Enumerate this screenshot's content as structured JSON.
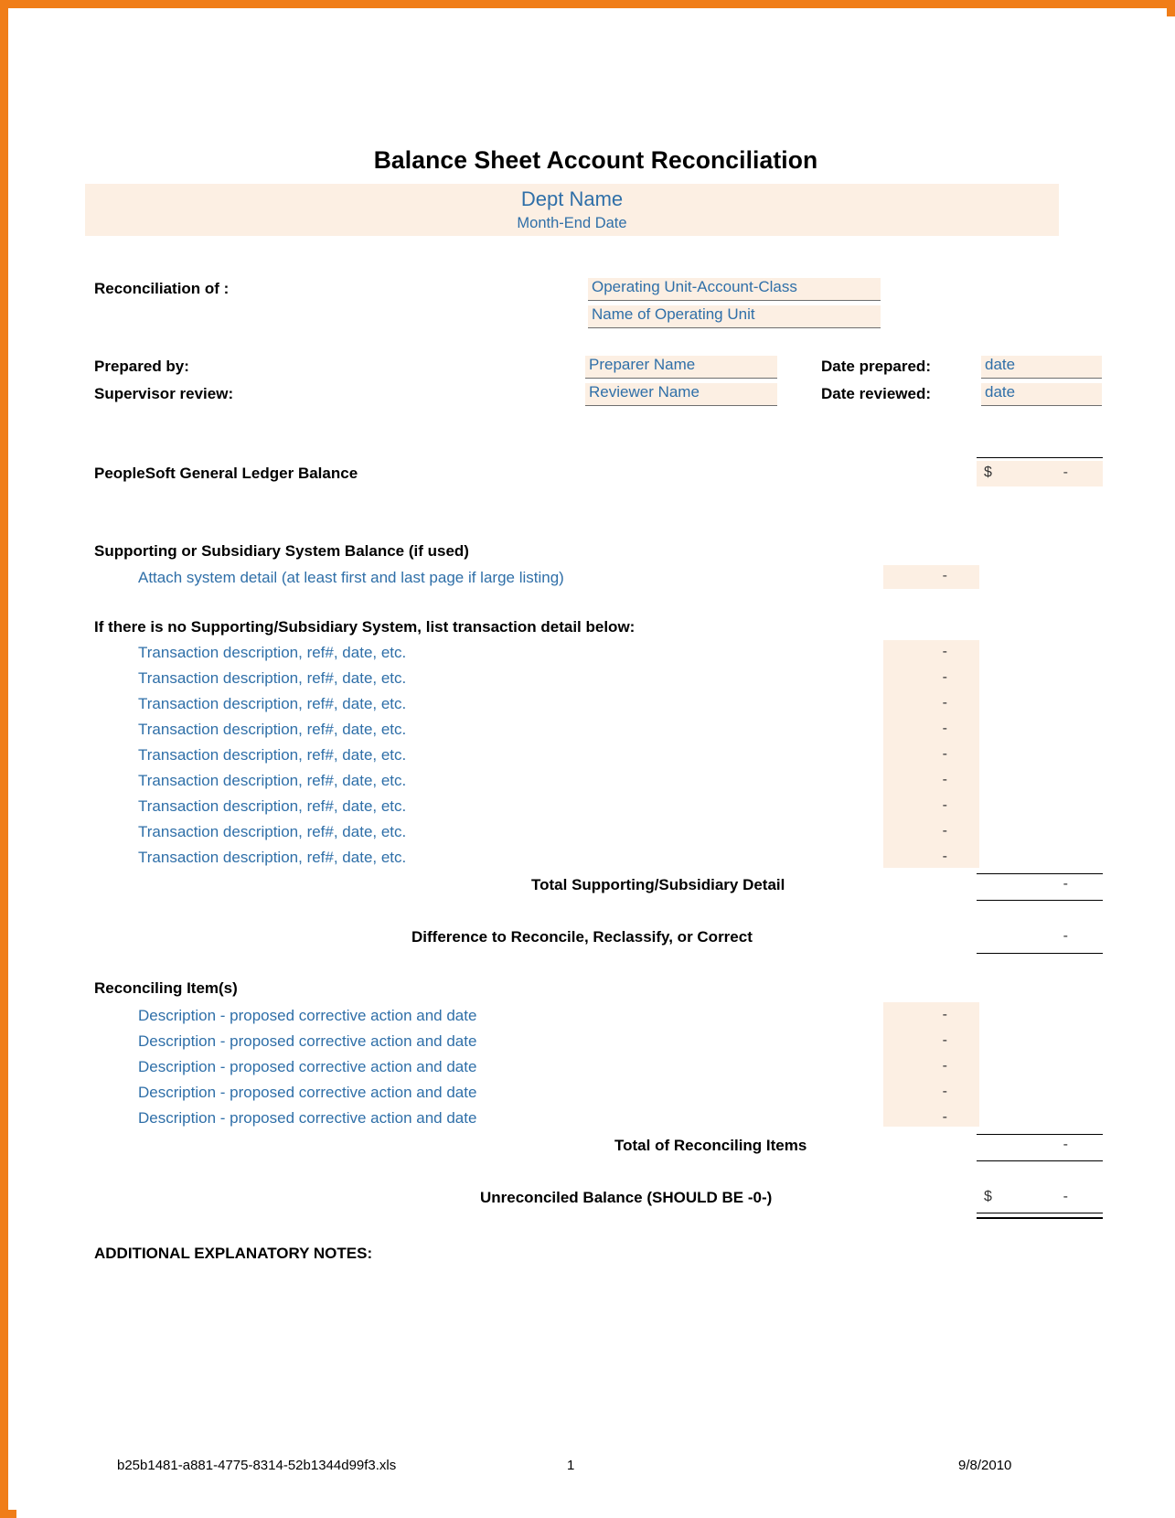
{
  "document": {
    "title": "Balance Sheet Account Reconciliation",
    "header_band": {
      "dept": "Dept Name",
      "period": "Month-End Date"
    },
    "reconciliation_of": {
      "label": "Reconciliation of :",
      "line1": "Operating Unit-Account-Class",
      "line2": "Name of Operating Unit"
    },
    "signoff": {
      "prepared_by_label": "Prepared by:",
      "prepared_by_value": "Preparer Name",
      "date_prepared_label": "Date prepared:",
      "date_prepared_value": "date",
      "supervisor_label": "Supervisor review:",
      "supervisor_value": "Reviewer Name",
      "date_reviewed_label": "Date reviewed:",
      "date_reviewed_value": "date"
    },
    "gl_balance": {
      "label": "PeopleSoft General Ledger Balance",
      "currency": "$",
      "value": "-"
    },
    "supporting": {
      "heading": "Supporting or Subsidiary System Balance (if used)",
      "note": "Attach system detail (at least first and last page if large listing)",
      "value": "-"
    },
    "transactions": {
      "heading": "If there is no Supporting/Subsidiary System, list transaction detail below:",
      "rows": [
        {
          "description": "Transaction description, ref#, date, etc.",
          "value": "-"
        },
        {
          "description": "Transaction description, ref#, date, etc.",
          "value": "-"
        },
        {
          "description": "Transaction description, ref#, date, etc.",
          "value": "-"
        },
        {
          "description": "Transaction description, ref#, date, etc.",
          "value": "-"
        },
        {
          "description": "Transaction description, ref#, date, etc.",
          "value": "-"
        },
        {
          "description": "Transaction description, ref#, date, etc.",
          "value": "-"
        },
        {
          "description": "Transaction description, ref#, date, etc.",
          "value": "-"
        },
        {
          "description": "Transaction description, ref#, date, etc.",
          "value": "-"
        },
        {
          "description": "Transaction description, ref#, date, etc.",
          "value": "-"
        }
      ]
    },
    "total_supporting": {
      "label": "Total Supporting/Subsidiary Detail",
      "value": "-"
    },
    "difference": {
      "label": "Difference to Reconcile, Reclassify, or Correct",
      "value": "-"
    },
    "reconciling_items": {
      "heading": "Reconciling Item(s)",
      "rows": [
        {
          "description": "Description - proposed corrective action and date",
          "value": "-"
        },
        {
          "description": "Description - proposed corrective action and date",
          "value": "-"
        },
        {
          "description": "Description - proposed corrective action and date",
          "value": "-"
        },
        {
          "description": "Description - proposed corrective action and date",
          "value": "-"
        },
        {
          "description": "Description - proposed corrective action and date",
          "value": "-"
        }
      ],
      "total_label": "Total of Reconciling Items",
      "total_value": "-"
    },
    "unreconciled": {
      "label": "Unreconciled Balance (SHOULD BE -0-)",
      "currency": "$",
      "value": "-"
    },
    "notes_heading": "ADDITIONAL EXPLANATORY NOTES:",
    "footer": {
      "filename": "b25b1481-a881-4775-8314-52b1344d99f3.xls",
      "page": "1",
      "date": "9/8/2010"
    }
  },
  "colors": {
    "frame": "#f07d18",
    "field_fill": "#fcefe3",
    "accent_text": "#2f6fa8"
  }
}
